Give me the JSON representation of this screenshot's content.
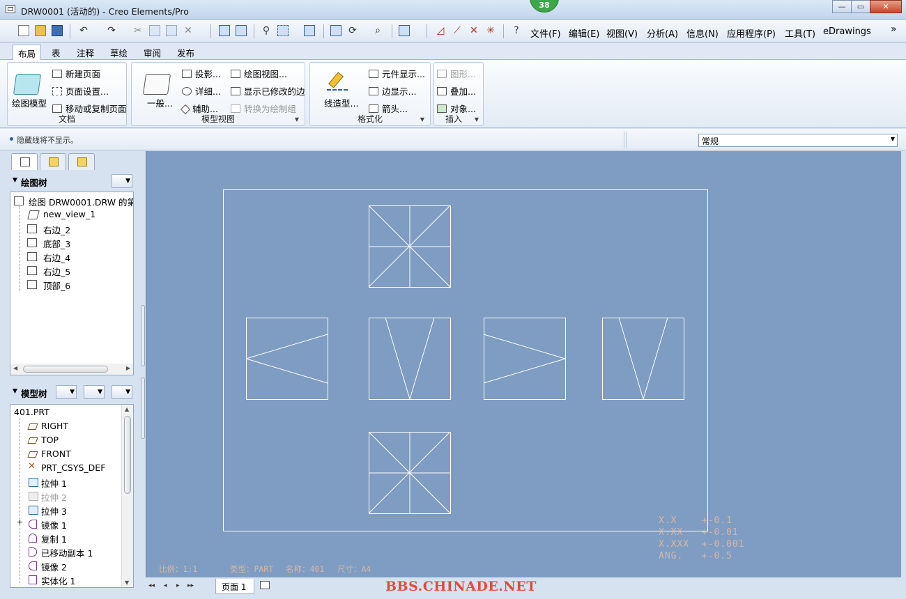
{
  "window": {
    "title": "DRW0001 (活动的) - Creo Elements/Pro",
    "badge": "38",
    "minimize": "—",
    "maximize": "▭",
    "close": "✕"
  },
  "menus": [
    "文件(F)",
    "编辑(E)",
    "视图(V)",
    "分析(A)",
    "信息(N)",
    "应用程序(P)",
    "工具(T)",
    "eDrawings"
  ],
  "overflow": "»",
  "tabs": [
    "布局",
    "表",
    "注释",
    "草绘",
    "审阅",
    "发布"
  ],
  "ribbon": {
    "doc": {
      "big": "绘图模型",
      "items": [
        "新建页面",
        "页面设置...",
        "移动或复制页面"
      ],
      "label": "文档"
    },
    "views": {
      "big": "一般...",
      "col1": [
        "投影...",
        "详细...",
        "辅助..."
      ],
      "col2": [
        "绘图视图...",
        "显示已修改的边",
        "转换为绘制组"
      ],
      "label": "模型视图"
    },
    "format": {
      "big": "线造型...",
      "items": [
        "元件显示...",
        "边显示...",
        "箭头..."
      ],
      "label": "格式化"
    },
    "insert": {
      "items": [
        "图形...",
        "叠加...",
        "对象..."
      ],
      "label": "插入"
    }
  },
  "message": "隐藏线将不显示。",
  "filter": "常规",
  "drawing_tree": {
    "header": "绘图树",
    "items": [
      "绘图 DRW0001.DRW 的第",
      "new_view_1",
      "右边_2",
      "底部_3",
      "右边_4",
      "右边_5",
      "顶部_6"
    ]
  },
  "model_tree": {
    "header": "模型树",
    "items": [
      "401.PRT",
      "RIGHT",
      "TOP",
      "FRONT",
      "PRT_CSYS_DEF",
      "拉伸 1",
      "拉伸 2",
      "拉伸 3",
      "镜像 1",
      "复制 1",
      "已移动副本 1",
      "镜像 2",
      "实体化 1"
    ],
    "expander": "+"
  },
  "drawing": {
    "tolerances": [
      "X.X    +-0.1",
      "X.XX   +-0.01",
      "X.XXX  +-0.001",
      "ANG.   +-0.5"
    ],
    "scale": "比例：1:1",
    "type": "类型：PART",
    "name": "名称：401",
    "size": "尺寸：A4"
  },
  "pagebar": {
    "page": "页面  1",
    "nav": [
      "◂◂",
      "◂",
      "▸",
      "▸▸"
    ]
  },
  "watermark": "BBS.CHINADE.NET"
}
